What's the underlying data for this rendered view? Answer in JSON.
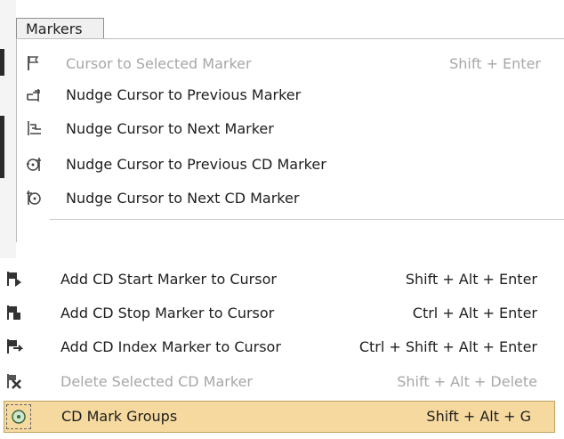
{
  "menu": {
    "title": "Markers"
  },
  "items_top": [
    {
      "label": "Cursor to Selected Marker",
      "shortcut": "Shift + Enter",
      "icon": "flag-cursor-icon",
      "disabled": true
    },
    {
      "label": "Nudge Cursor to Previous Marker",
      "shortcut": "",
      "icon": "nudge-previous-marker-icon",
      "disabled": false
    },
    {
      "label": "Nudge Cursor to Next Marker",
      "shortcut": "",
      "icon": "nudge-next-marker-icon",
      "disabled": false
    },
    {
      "label": "Nudge Cursor to Previous CD Marker",
      "shortcut": "",
      "icon": "nudge-previous-cd-marker-icon",
      "disabled": false
    },
    {
      "label": "Nudge Cursor to Next CD Marker",
      "shortcut": "",
      "icon": "nudge-next-cd-marker-icon",
      "disabled": false
    }
  ],
  "items_bottom": [
    {
      "label": "Add CD Start Marker to Cursor",
      "shortcut": "Shift + Alt + Enter",
      "icon": "cd-start-marker-icon",
      "disabled": false
    },
    {
      "label": "Add CD Stop Marker to Cursor",
      "shortcut": "Ctrl + Alt + Enter",
      "icon": "cd-stop-marker-icon",
      "disabled": false
    },
    {
      "label": "Add CD Index Marker to Cursor",
      "shortcut": "Ctrl + Shift + Alt + Enter",
      "icon": "cd-index-marker-icon",
      "disabled": false
    },
    {
      "label": "Delete Selected CD Marker",
      "shortcut": "Shift + Alt + Delete",
      "icon": "delete-cd-marker-icon",
      "disabled": true
    },
    {
      "label": "CD Mark Groups",
      "shortcut": "Shift + Alt + G",
      "icon": "cd-mark-groups-icon",
      "disabled": false,
      "highlighted": true
    }
  ],
  "colors": {
    "highlight": "#f6d99f",
    "highlight_border": "#bfa25e",
    "disabled_text": "#a7a7a7"
  }
}
